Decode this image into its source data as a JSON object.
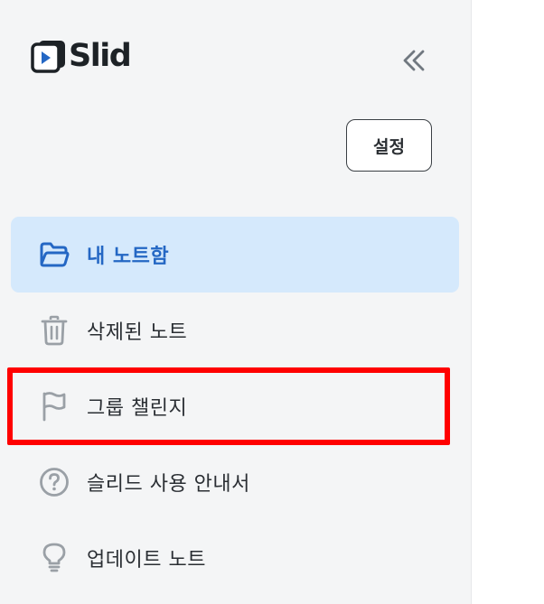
{
  "app": {
    "name": "Slid"
  },
  "header": {
    "collapse_label": "«"
  },
  "settings": {
    "label": "설정"
  },
  "nav": {
    "items": [
      {
        "label": "내 노트함",
        "icon": "folder-icon",
        "active": true
      },
      {
        "label": "삭제된 노트",
        "icon": "trash-icon",
        "active": false
      },
      {
        "label": "그룹 챌린지",
        "icon": "flag-icon",
        "active": false,
        "highlighted": true
      },
      {
        "label": "슬리드 사용 안내서",
        "icon": "help-circle-icon",
        "active": false
      },
      {
        "label": "업데이트 노트",
        "icon": "lightbulb-icon",
        "active": false
      }
    ]
  },
  "colors": {
    "sidebar_bg": "#f4f5f6",
    "active_bg": "#d5e9fc",
    "active_text": "#2467c4",
    "icon_gray": "#9aa0a6",
    "highlight": "#ff0000"
  }
}
